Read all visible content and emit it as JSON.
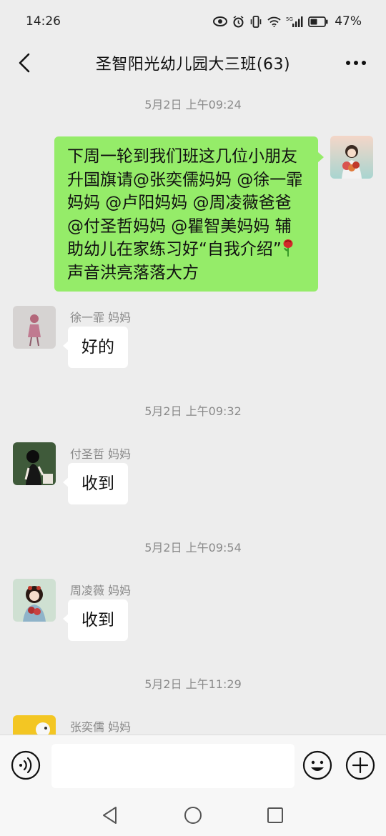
{
  "status_bar": {
    "time": "14:26",
    "battery_percent": "47%",
    "icons": [
      "eye-icon",
      "alarm-icon",
      "vibrate-icon",
      "wifi-icon",
      "signal-5g-icon",
      "battery-icon"
    ]
  },
  "header": {
    "title": "圣智阳光幼儿园大三班(63)",
    "back_icon": "chevron-left-icon",
    "more_icon": "more-horizontal-icon"
  },
  "messages": [
    {
      "type": "timestamp",
      "text": "5月2日 上午09:24"
    },
    {
      "type": "outgoing",
      "text_before": "下周一轮到我们班这几位小朋友升国旗请@张奕儒妈妈 @徐一霏妈妈 @卢阳妈妈 @周凌薇爸爸 @付圣哲妈妈 @瞿智美妈妈 辅助幼儿在家练习好“自我介绍”",
      "emoji": "rose",
      "text_after": "声音洪亮落落大方"
    },
    {
      "type": "incoming",
      "sender": "徐一霏  妈妈",
      "text": "好的"
    },
    {
      "type": "timestamp",
      "text": "5月2日 上午09:32"
    },
    {
      "type": "incoming",
      "sender": "付圣哲  妈妈",
      "text": "收到"
    },
    {
      "type": "timestamp",
      "text": "5月2日 上午09:54"
    },
    {
      "type": "incoming",
      "sender": "周凌薇  妈妈",
      "text": "收到"
    },
    {
      "type": "timestamp",
      "text": "5月2日 上午11:29"
    },
    {
      "type": "incoming",
      "sender": "张奕儒  妈妈",
      "text": ""
    }
  ],
  "input_bar": {
    "voice_icon": "voice-icon",
    "input_value": "",
    "emoji_icon": "emoji-icon",
    "plus_icon": "plus-icon"
  },
  "nav_bar": {
    "icons": [
      "back-triangle-icon",
      "home-circle-icon",
      "recents-square-icon"
    ]
  },
  "colors": {
    "background": "#ededed",
    "outgoing_bubble": "#95ec69",
    "incoming_bubble": "#ffffff",
    "timestamp_text": "#8a8a8a"
  }
}
